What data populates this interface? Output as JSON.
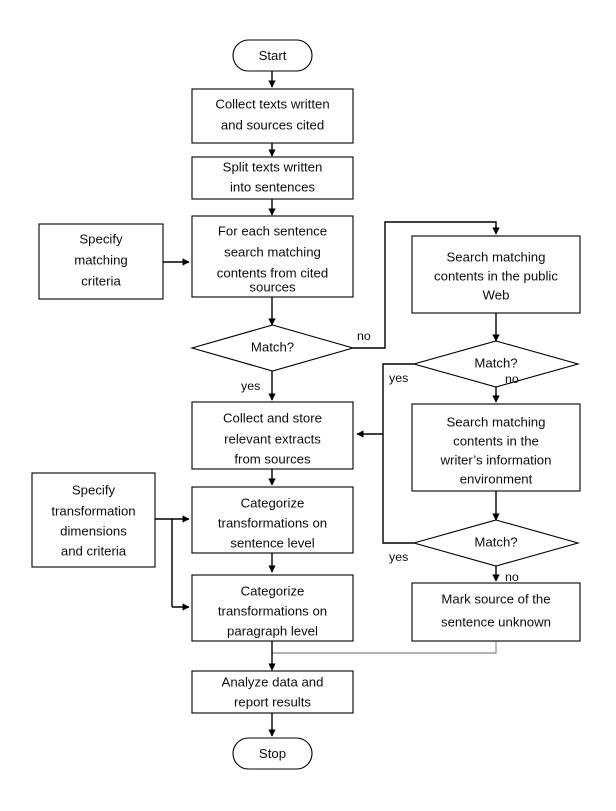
{
  "diagram": {
    "type": "flowchart",
    "title": "",
    "nodes": [
      {
        "id": "start",
        "shape": "terminator",
        "lines": [
          "Start"
        ]
      },
      {
        "id": "collect",
        "shape": "process",
        "lines": [
          "Collect  texts written",
          "and sources cited"
        ]
      },
      {
        "id": "split",
        "shape": "process",
        "lines": [
          "Split texts written",
          "into sentences"
        ]
      },
      {
        "id": "specify_match",
        "shape": "process",
        "lines": [
          "Specify",
          "matching",
          "criteria"
        ]
      },
      {
        "id": "foreach",
        "shape": "process",
        "lines": [
          "For each sentence",
          "search matching",
          "contents from cited",
          "sources"
        ]
      },
      {
        "id": "match1",
        "shape": "decision",
        "lines": [
          "Match?"
        ]
      },
      {
        "id": "web",
        "shape": "process",
        "lines": [
          "Search matching",
          "contents in the public",
          "Web"
        ]
      },
      {
        "id": "match2",
        "shape": "decision",
        "lines": [
          "Match?"
        ]
      },
      {
        "id": "store",
        "shape": "process",
        "lines": [
          "Collect and store",
          "relevant extracts",
          "from sources"
        ]
      },
      {
        "id": "writer",
        "shape": "process",
        "lines": [
          "Search matching",
          "contents in the",
          "writer’s information",
          "environment"
        ]
      },
      {
        "id": "specify_trans",
        "shape": "process",
        "lines": [
          "Specify",
          "transformation",
          "dimensions",
          "and criteria"
        ]
      },
      {
        "id": "cat_sentence",
        "shape": "process",
        "lines": [
          "Categorize",
          "transformations on",
          "sentence level"
        ]
      },
      {
        "id": "match3",
        "shape": "decision",
        "lines": [
          "Match?"
        ]
      },
      {
        "id": "cat_paragraph",
        "shape": "process",
        "lines": [
          "Categorize",
          "transformations on",
          "paragraph level"
        ]
      },
      {
        "id": "mark",
        "shape": "process",
        "lines": [
          "Mark source of the",
          "sentence unknown"
        ]
      },
      {
        "id": "analyze",
        "shape": "process",
        "lines": [
          "Analyze data and",
          "report  results"
        ]
      },
      {
        "id": "stop",
        "shape": "terminator",
        "lines": [
          "Stop"
        ]
      }
    ],
    "edge_labels": {
      "match1_no": "no",
      "match1_yes": "yes",
      "match2_yes": "yes",
      "match2_no": "no",
      "match3_yes": "yes",
      "match3_no": "no"
    },
    "colors": {
      "stroke": "#000000",
      "fill": "#ffffff",
      "text": "#0d0d0d",
      "gray_connector": "#9a9a9a"
    }
  }
}
